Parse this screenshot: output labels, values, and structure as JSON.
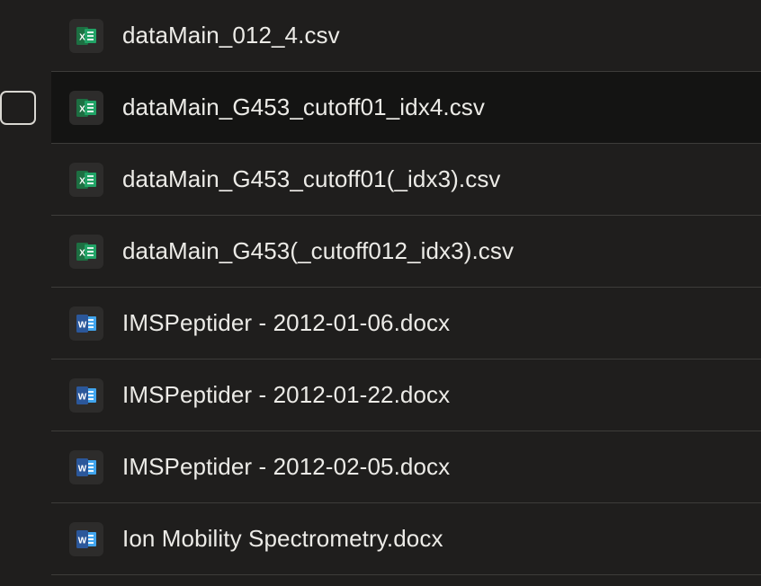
{
  "files": [
    {
      "name": "dataMain_012_4.csv",
      "icon": "excel-icon",
      "type": "csv"
    },
    {
      "name": "dataMain_G453_cutoff01_idx4.csv",
      "icon": "excel-icon",
      "type": "csv",
      "hovered": true
    },
    {
      "name": "dataMain_G453_cutoff01(_idx3).csv",
      "icon": "excel-icon",
      "type": "csv"
    },
    {
      "name": "dataMain_G453(_cutoff012_idx3).csv",
      "icon": "excel-icon",
      "type": "csv"
    },
    {
      "name": "IMSPeptider - 2012-01-06.docx",
      "icon": "word-icon",
      "type": "docx"
    },
    {
      "name": "IMSPeptider - 2012-01-22.docx",
      "icon": "word-icon",
      "type": "docx"
    },
    {
      "name": "IMSPeptider - 2012-02-05.docx",
      "icon": "word-icon",
      "type": "docx"
    },
    {
      "name": "Ion Mobility Spectrometry.docx",
      "icon": "word-icon",
      "type": "docx"
    }
  ],
  "colors": {
    "background": "#1f1e1d",
    "hover_row": "#141413",
    "divider": "#3d3c3a",
    "text": "#ecebe7",
    "excel_green": "#1d6f42",
    "word_blue": "#2b579a"
  }
}
